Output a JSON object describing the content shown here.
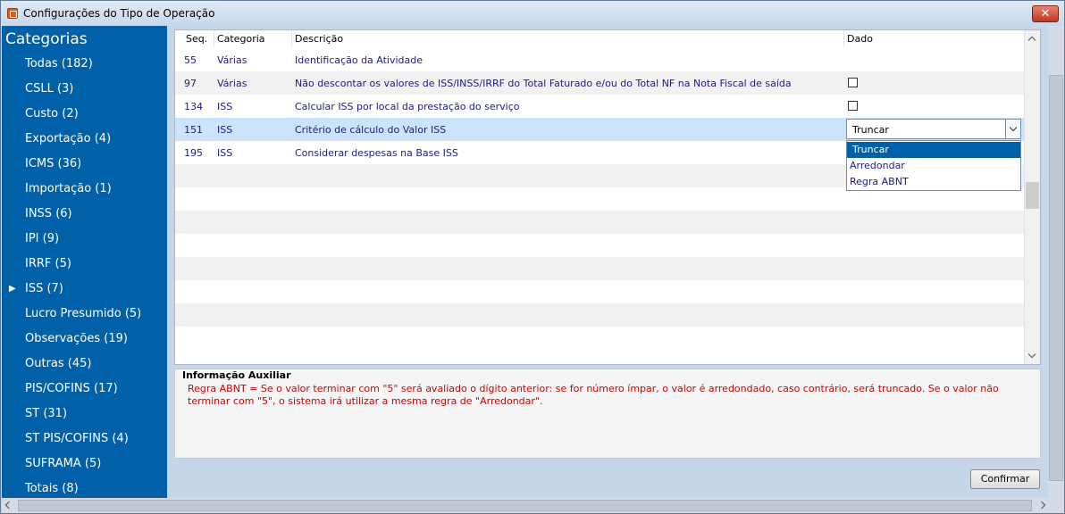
{
  "window": {
    "title": "Configurações do Tipo de Operação",
    "close_label": "✕"
  },
  "sidebar": {
    "title": "Categorias",
    "selected_index": 9,
    "items": [
      {
        "label": "Todas (182)"
      },
      {
        "label": "CSLL (3)"
      },
      {
        "label": "Custo (2)"
      },
      {
        "label": "Exportação (4)"
      },
      {
        "label": "ICMS (36)"
      },
      {
        "label": "Importação (1)"
      },
      {
        "label": "INSS (6)"
      },
      {
        "label": "IPI (9)"
      },
      {
        "label": "IRRF (5)"
      },
      {
        "label": "ISS (7)"
      },
      {
        "label": "Lucro Presumido (5)"
      },
      {
        "label": "Observações (19)"
      },
      {
        "label": "Outras (45)"
      },
      {
        "label": "PIS/COFINS (17)"
      },
      {
        "label": "ST (31)"
      },
      {
        "label": "ST PIS/COFINS (4)"
      },
      {
        "label": "SUFRAMA (5)"
      },
      {
        "label": "Totais (8)"
      }
    ]
  },
  "grid": {
    "columns": {
      "seq": "Seq.",
      "categoria": "Categoria",
      "descricao": "Descrição",
      "dado": "Dado"
    },
    "rows": [
      {
        "seq": "55",
        "categoria": "Várias",
        "descricao": "Identificação da Atividade",
        "dado_type": "none"
      },
      {
        "seq": "97",
        "categoria": "Várias",
        "descricao": "Não descontar os valores de ISS/INSS/IRRF do Total Faturado e/ou do Total NF na Nota Fiscal de saída",
        "dado_type": "checkbox",
        "checked": false
      },
      {
        "seq": "134",
        "categoria": "ISS",
        "descricao": "Calcular ISS por local da prestação do serviço",
        "dado_type": "checkbox",
        "checked": false
      },
      {
        "seq": "151",
        "categoria": "ISS",
        "descricao": "Critério de cálculo do Valor ISS",
        "dado_type": "combo",
        "selected": true
      },
      {
        "seq": "195",
        "categoria": "ISS",
        "descricao": "Considerar despesas na Base ISS",
        "dado_type": "none"
      }
    ],
    "combo": {
      "value": "Truncar",
      "options": [
        "Truncar",
        "Arredondar",
        "Regra ABNT"
      ],
      "highlighted_index": 0
    }
  },
  "info": {
    "title": "Informação Auxiliar",
    "text": "Regra ABNT = Se o valor terminar com \"5\" será avaliado o dígito anterior: se for número ímpar, o valor é arredondado, caso contrário, será truncado. Se o valor não terminar com \"5\", o sistema irá utilizar a mesma regra de \"Arredondar\"."
  },
  "actions": {
    "confirm_label": "Confirmar"
  },
  "colors": {
    "sidebar_bg": "#0060a8",
    "selected_row": "#cce4fb",
    "info_text": "#d00000",
    "grid_text": "#1a1a8c"
  }
}
